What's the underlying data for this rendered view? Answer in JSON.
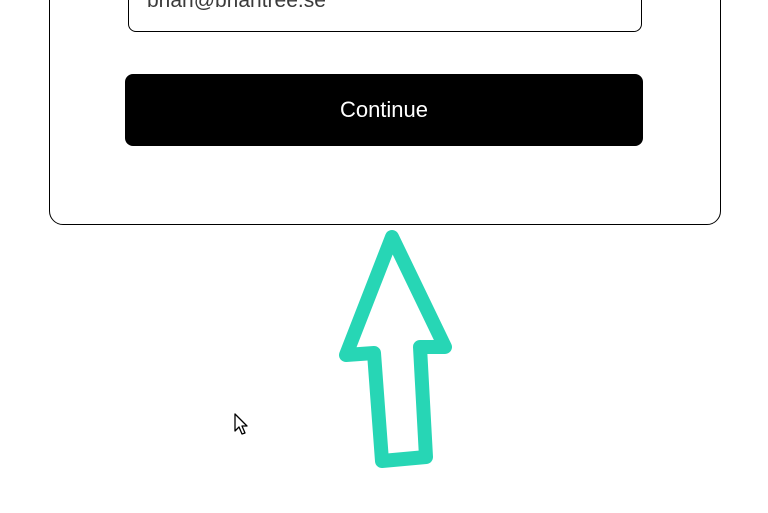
{
  "form": {
    "email_value": "brian@briantree.se",
    "continue_label": "Continue"
  },
  "annotation": {
    "arrow_color": "#27d6b5"
  }
}
